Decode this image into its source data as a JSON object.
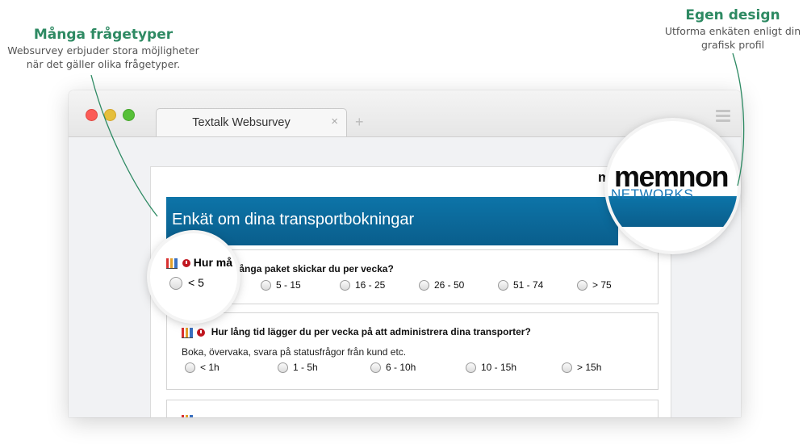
{
  "callouts": {
    "left": {
      "title": "Många frågetyper",
      "text_line1": "Websurvey erbjuder stora möjligheter",
      "text_line2": "när det gäller olika frågetyper."
    },
    "right": {
      "title": "Egen design",
      "text_line1": "Utforma enkäten enligt din",
      "text_line2": "grafisk profil"
    }
  },
  "browser": {
    "tab_title": "Textalk Websurvey",
    "tab_close": "×",
    "new_tab": "+"
  },
  "survey": {
    "banner_title": "Enkät om dina transportbokningar",
    "logo_main": "memnon",
    "logo_sub": "NETWORKS",
    "logo_fragment": "m",
    "questions": [
      {
        "title": "Hur många paket skickar du per vecka?",
        "options": [
          "< 5",
          "5 - 15",
          "16 - 25",
          "26 - 50",
          "51 - 74",
          "> 75"
        ]
      },
      {
        "title": "Hur lång tid lägger du per vecka på att administrera dina transporter?",
        "help": "Boka, övervaka, svara på statusfrågor från kund etc.",
        "options": [
          "< 1h",
          "1 - 5h",
          "6 - 10h",
          "10 - 15h",
          "> 15h"
        ]
      }
    ],
    "zoom_title": "Hur må",
    "zoom_option": "< 5"
  },
  "colors": {
    "accent_green": "#2e8a63",
    "banner_blue": "#0b6a9a",
    "logo_blue": "#1877b8"
  }
}
